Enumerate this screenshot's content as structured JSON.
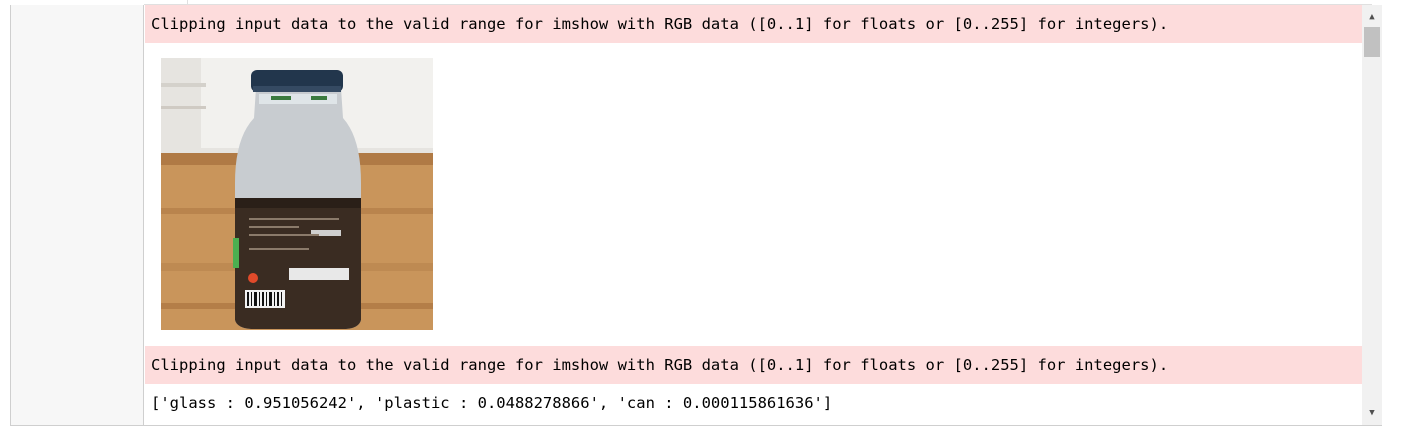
{
  "cell_output": {
    "warnings": [
      "Clipping input data to the valid range for imshow with RGB data ([0..1] for floats or [0..255] for integers).",
      "Clipping input data to the valid range for imshow with RGB data ([0..1] for floats or [0..255] for integers)."
    ],
    "prediction_result": "['glass : 0.951056242', 'plastic : 0.0488278866', 'can : 0.000115861636']"
  },
  "scrollbar": {
    "up_icon": "triangle-up-icon",
    "down_icon": "triangle-down-icon",
    "position": 0.0
  },
  "colors": {
    "stderr_background": "#fddcdc",
    "gutter_background": "#f7f7f7",
    "border": "#cfcfcf"
  }
}
